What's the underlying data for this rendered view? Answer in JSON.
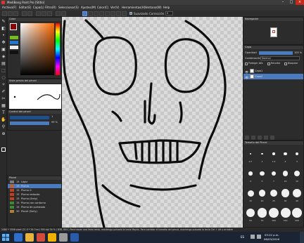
{
  "window": {
    "title": "MediBang Paint Pro [Stitlo]"
  },
  "menu": [
    "Archivo(F)",
    "Editar(E)",
    "Capa(L)",
    "Filtro(R)",
    "Seleccionar(S)",
    "Ajustes(M)",
    "Color(C)",
    "Ver(V)",
    "Herramientas(H)",
    "Ventana(W)",
    "Help"
  ],
  "toolbar": {
    "suavizado_label": "Suavizado",
    "correccion_label": "Corrección",
    "correccion_value": "0"
  },
  "color_panel": {
    "title": "Color",
    "primary": "#8b0000",
    "secondary": "#ffffff"
  },
  "brush_preview": {
    "title": "Vista previa del pincel"
  },
  "brush_control": {
    "title": "Control del pincel",
    "size_value": "1",
    "opacity_value": "99 %"
  },
  "brush_list": {
    "title": "Pincel",
    "items": [
      {
        "num": "15",
        "name": "Lápiz",
        "color": "#7a7a7a"
      },
      {
        "num": "15",
        "name": "Pluma",
        "color": "#d06020",
        "selected": true
      },
      {
        "num": "15",
        "name": "Pluma G",
        "color": "#c04020"
      },
      {
        "num": "15",
        "name": "Pluma redonda",
        "color": "#c04020"
      },
      {
        "num": "15",
        "name": "Pluma (Smly)",
        "color": "#c04020"
      },
      {
        "num": "15",
        "name": "Pluma con contorno",
        "color": "#3a8a3a"
      },
      {
        "num": "15",
        "name": "Pluma de purbeada",
        "color": "#3a8a3a"
      },
      {
        "num": "30",
        "name": "Pincel (Smly)",
        "color": "#b08030"
      }
    ]
  },
  "navigator": {
    "title": "Navegador"
  },
  "layers": {
    "title": "Capa",
    "opacity_label": "Opacidad",
    "opacity_value": "100 %",
    "blend_label": "Combinación",
    "blend_value": "Normal",
    "protect_alpha": "Proteger alfa",
    "clipping": "Recortar",
    "lock": "Bloquear",
    "items": [
      {
        "name": "Capa1",
        "selected": false
      },
      {
        "name": "Capa2",
        "selected": true
      }
    ]
  },
  "brush_size": {
    "title": "Tamaño del Pincel",
    "sizes": [
      "0.7",
      "1",
      "1.5",
      "2",
      "3",
      "4",
      "5",
      "7",
      "10",
      "12",
      "15",
      "20",
      "25",
      "30",
      "40",
      "50",
      "70",
      "100",
      "150",
      "200"
    ]
  },
  "status": {
    "text": "2480 * 3508 pixel  (21.0 * 29.7cm)  300 dpi  34 %  ( 838, 804 )  Para trazar una línea recta, mantenga pulsada la tecla Mayús. Para cambiar el tamaño del pincel, mantenga pulsada la tecla Ctrl + Alt y arrastre"
  },
  "taskbar": {
    "lang": "ES",
    "time": "03:22 p.m.",
    "date": "06/03/2016"
  }
}
